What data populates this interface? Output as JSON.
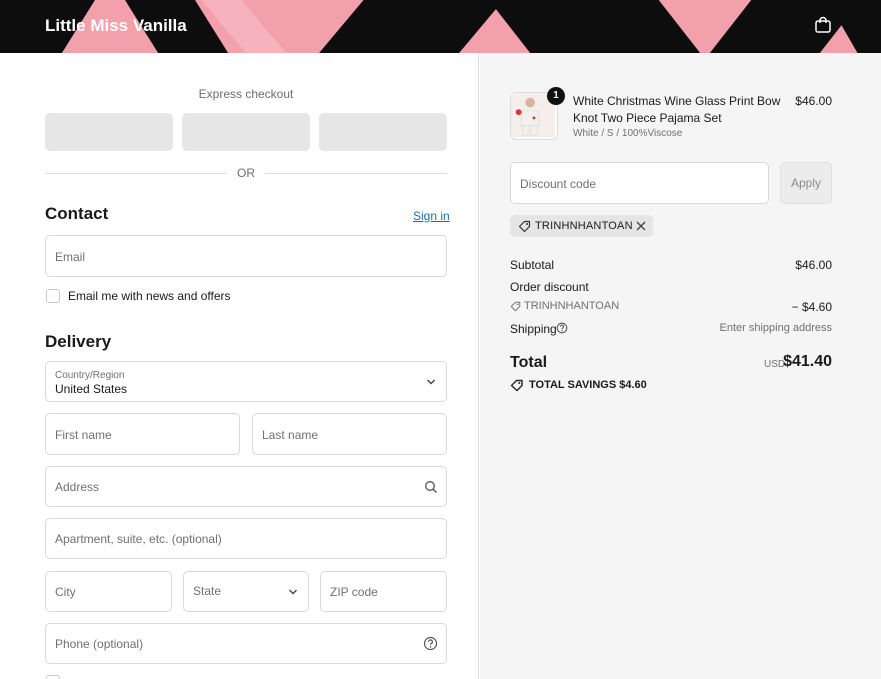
{
  "header": {
    "store_name": "Little Miss Vanilla",
    "bag_icon": "shopping-bag-icon"
  },
  "express": {
    "label": "Express checkout",
    "or": "OR"
  },
  "contact": {
    "title": "Contact",
    "signin": "Sign in",
    "email_placeholder": "Email",
    "newsletter_label": "Email me with news and offers"
  },
  "delivery": {
    "title": "Delivery",
    "country_label": "Country/Region",
    "country_value": "United States",
    "first_name": "First name",
    "last_name": "Last name",
    "address": "Address",
    "apartment": "Apartment, suite, etc. (optional)",
    "city": "City",
    "state": "State",
    "zip": "ZIP code",
    "phone": "Phone (optional)"
  },
  "summary": {
    "quantity": "1",
    "product_name": "White Christmas Wine Glass Print Bow Knot Two Piece Pajama Set",
    "product_variant": "White / S / 100%Viscose",
    "product_price": "$46.00",
    "discount_placeholder": "Discount code",
    "apply": "Apply",
    "code_chip": "TRINHNHANTOAN",
    "subtotal_label": "Subtotal",
    "subtotal_value": "$46.00",
    "order_discount_label": "Order discount",
    "discount_code": "TRINHNHANTOAN",
    "discount_value": "− $4.60",
    "shipping_label": "Shipping",
    "shipping_value": "Enter shipping address",
    "total_label": "Total",
    "currency": "USD",
    "total_value": "$41.40",
    "savings_label": "TOTAL SAVINGS",
    "savings_value": "$4.60"
  },
  "colors": {
    "header_pink": "#f3a0ad",
    "link_blue": "#1773b0",
    "sidebar_bg": "#f5f5f5"
  }
}
